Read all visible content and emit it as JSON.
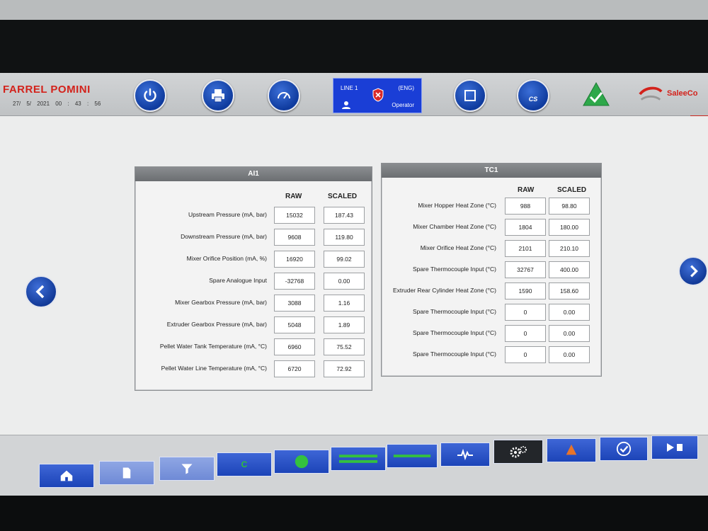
{
  "header": {
    "brand": "FARREL POMINI",
    "date": "27/ 5/ 2021",
    "time": "00 : 43 : 56",
    "line_label": "LINE 1",
    "language": "(ENG)",
    "user_role": "Operator",
    "vendor": "SaleeCo"
  },
  "ai1": {
    "title": "AI1",
    "raw_header": "RAW",
    "scaled_header": "SCALED",
    "rows": [
      {
        "label": "Upstream Pressure (mA, bar)",
        "raw": "15032",
        "scaled": "187.43"
      },
      {
        "label": "Downstream Pressure (mA, bar)",
        "raw": "9608",
        "scaled": "119.80"
      },
      {
        "label": "Mixer Orifice Position (mA, %)",
        "raw": "16920",
        "scaled": "99.02"
      },
      {
        "label": "Spare Analogue Input",
        "raw": "-32768",
        "scaled": "0.00"
      },
      {
        "label": "Mixer Gearbox Pressure (mA, bar)",
        "raw": "3088",
        "scaled": "1.16"
      },
      {
        "label": "Extruder Gearbox Pressure (mA, bar)",
        "raw": "5048",
        "scaled": "1.89"
      },
      {
        "label": "Pellet Water Tank Temperature (mA, °C)",
        "raw": "6960",
        "scaled": "75.52"
      },
      {
        "label": "Pellet Water Line Temperature (mA, °C)",
        "raw": "6720",
        "scaled": "72.92"
      }
    ]
  },
  "tc1": {
    "title": "TC1",
    "raw_header": "RAW",
    "scaled_header": "SCALED",
    "rows": [
      {
        "label": "Mixer Hopper Heat Zone (°C)",
        "raw": "988",
        "scaled": "98.80"
      },
      {
        "label": "Mixer Chamber Heat Zone (°C)",
        "raw": "1804",
        "scaled": "180.00"
      },
      {
        "label": "Mixer Orifice Heat Zone (°C)",
        "raw": "2101",
        "scaled": "210.10"
      },
      {
        "label": "Spare Thermocouple Input (°C)",
        "raw": "32767",
        "scaled": "400.00"
      },
      {
        "label": "Extruder Rear Cylinder Heat Zone (°C)",
        "raw": "1590",
        "scaled": "158.60"
      },
      {
        "label": "Spare Thermocouple Input (°C)",
        "raw": "0",
        "scaled": "0.00"
      },
      {
        "label": "Spare Thermocouple Input (°C)",
        "raw": "0",
        "scaled": "0.00"
      },
      {
        "label": "Spare Thermocouple Input (°C)",
        "raw": "0",
        "scaled": "0.00"
      }
    ]
  },
  "toolbar": {
    "cs_label": "CS"
  },
  "colors": {
    "brand_red": "#d3221b",
    "button_blue": "#1c44b8",
    "status_green": "#2ea84a"
  }
}
